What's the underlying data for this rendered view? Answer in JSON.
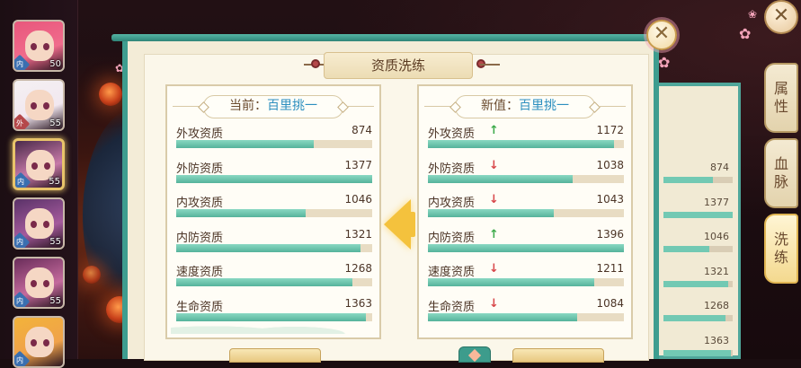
{
  "dialog": {
    "title": "资质洗练",
    "close_icon": "close-icon"
  },
  "current": {
    "label": "当前：",
    "hero": "百里挑一",
    "stats": [
      {
        "name": "外攻资质",
        "value": 874,
        "fill": 0.7
      },
      {
        "name": "外防资质",
        "value": 1377,
        "fill": 1.0
      },
      {
        "name": "内攻资质",
        "value": 1046,
        "fill": 0.66
      },
      {
        "name": "内防资质",
        "value": 1321,
        "fill": 0.94
      },
      {
        "name": "速度资质",
        "value": 1268,
        "fill": 0.9
      },
      {
        "name": "生命资质",
        "value": 1363,
        "fill": 0.97
      }
    ]
  },
  "new": {
    "label": "新值：",
    "hero": "百里挑一",
    "stats": [
      {
        "name": "外攻资质",
        "value": 1172,
        "trend": "up",
        "fill": 0.95
      },
      {
        "name": "外防资质",
        "value": 1038,
        "trend": "down",
        "fill": 0.74
      },
      {
        "name": "内攻资质",
        "value": 1043,
        "trend": "down",
        "fill": 0.64
      },
      {
        "name": "内防资质",
        "value": 1396,
        "trend": "up",
        "fill": 1.0
      },
      {
        "name": "速度资质",
        "value": 1211,
        "trend": "down",
        "fill": 0.85
      },
      {
        "name": "生命资质",
        "value": 1084,
        "trend": "down",
        "fill": 0.76
      }
    ]
  },
  "back_panel": {
    "values": [
      "874",
      "1377",
      "1046",
      "1321",
      "1268",
      "1363"
    ]
  },
  "side_tabs": [
    {
      "label_1": "属",
      "label_2": "性"
    },
    {
      "label_1": "血",
      "label_2": "脉"
    },
    {
      "label_1": "洗",
      "label_2": "练",
      "active": true
    }
  ],
  "heroes": [
    {
      "level": "50",
      "tag": "内",
      "tag_color": "#3a6fb0"
    },
    {
      "level": "55",
      "tag": "外",
      "tag_color": "#b5484a"
    },
    {
      "level": "55",
      "tag": "内",
      "tag_color": "#3a6fb0",
      "selected": true
    },
    {
      "level": "55",
      "tag": "内",
      "tag_color": "#3a6fb0"
    },
    {
      "level": "55",
      "tag": "内",
      "tag_color": "#3a6fb0"
    },
    {
      "level": "",
      "tag": "内",
      "tag_color": "#3a6fb0"
    }
  ],
  "colors": {
    "accent_teal": "#3e9d8f",
    "value_blue": "#2d8fbf",
    "up": "#3caa4a",
    "down": "#d8474a",
    "bar_fill": "#72c9b3"
  },
  "arrows": {
    "up": "↑",
    "down": "↓"
  }
}
